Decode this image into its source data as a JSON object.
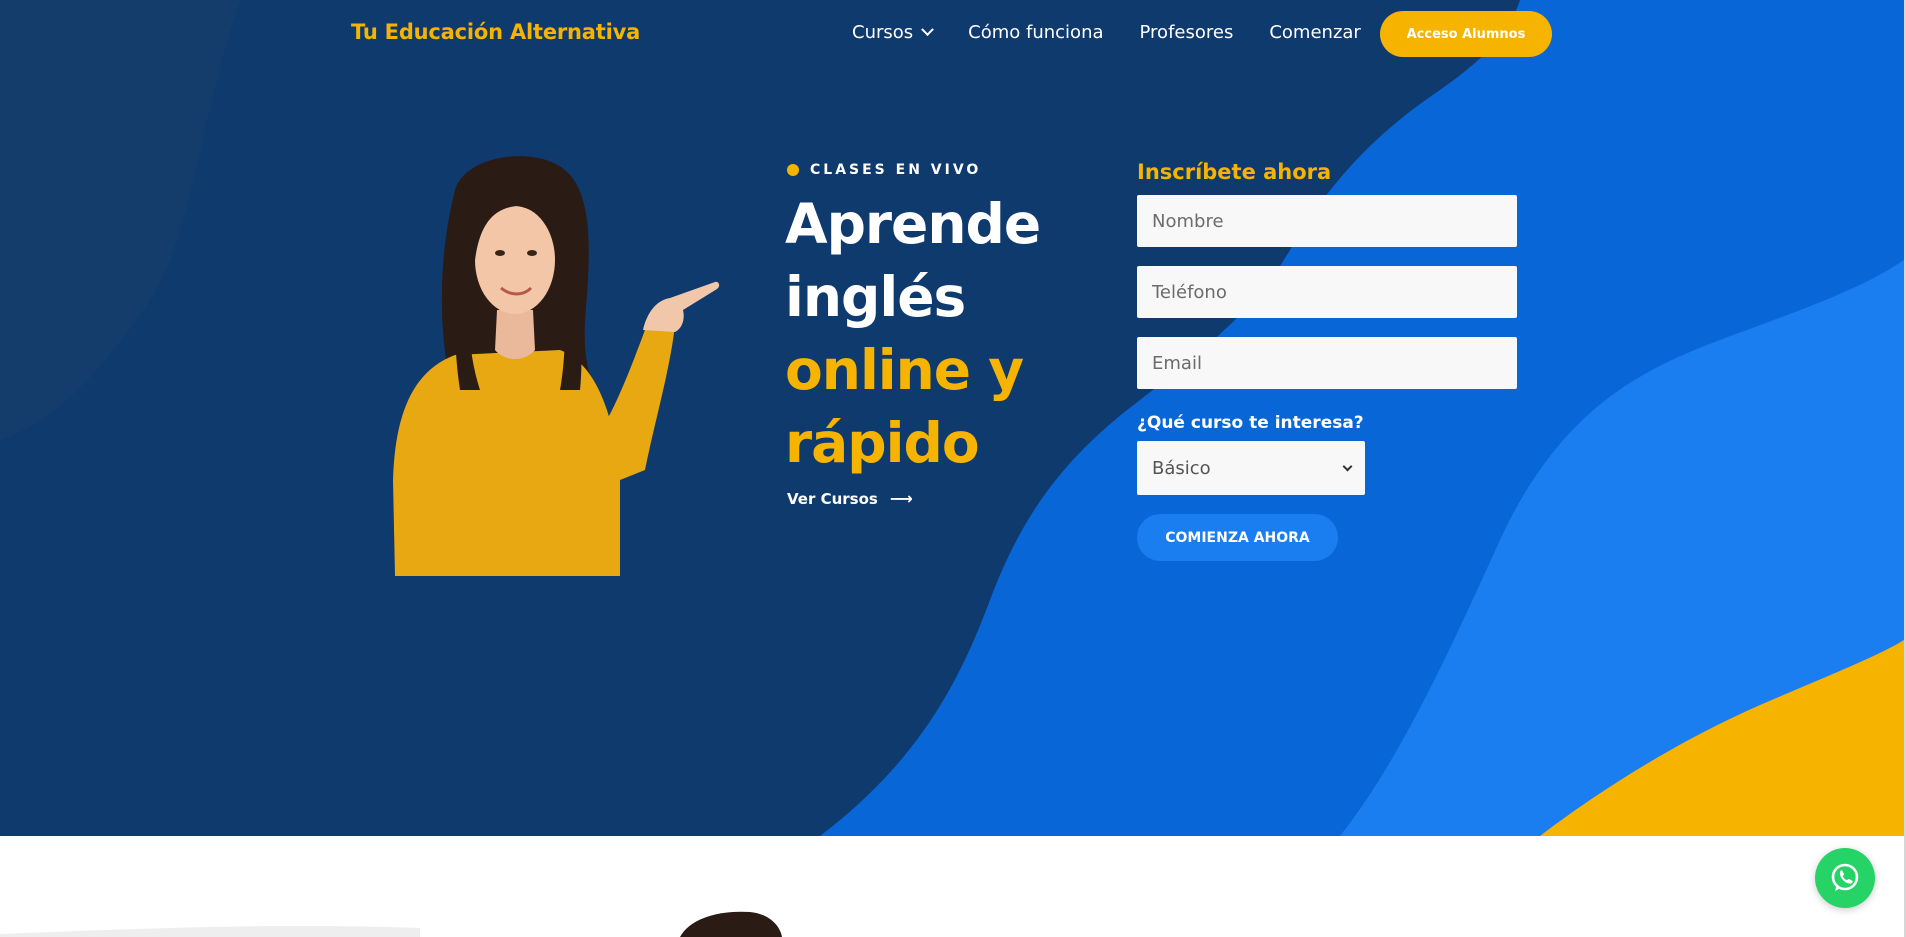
{
  "header": {
    "logo": "Tu Educación Alternativa",
    "nav": [
      {
        "label": "Cursos",
        "has_dropdown": true
      },
      {
        "label": "Cómo funciona"
      },
      {
        "label": "Profesores"
      },
      {
        "label": "Comenzar"
      }
    ],
    "cta_label": "Acceso Alumnos"
  },
  "hero": {
    "eyebrow": "CLASES EN VIVO",
    "headline_white_1": "Aprende",
    "headline_white_2": "inglés",
    "headline_yellow_1": "online y",
    "headline_yellow_2": "rápido",
    "link_label": "Ver Cursos",
    "link_icon": "arrow-right-icon"
  },
  "form": {
    "title": "Inscríbete ahora",
    "name_placeholder": "Nombre",
    "phone_placeholder": "Teléfono",
    "email_placeholder": "Email",
    "course_question": "¿Qué curso te interesa?",
    "course_selected": "Básico",
    "submit_label": "COMIENZA AHORA"
  },
  "colors": {
    "navy": "#0f3a6e",
    "blue": "#0866d6",
    "light_blue": "#1a7df0",
    "yellow": "#f6b400",
    "whatsapp": "#25d366"
  },
  "floating": {
    "icon": "whatsapp-icon"
  }
}
